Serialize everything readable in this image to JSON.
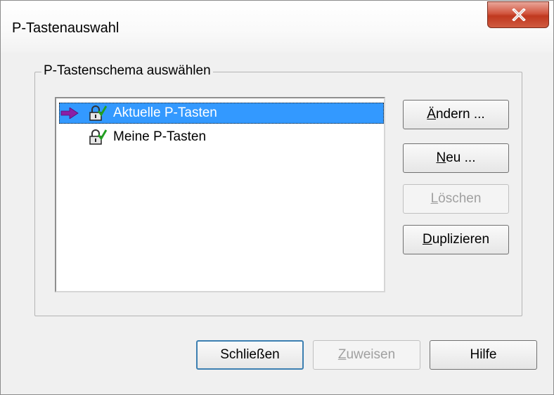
{
  "window": {
    "title": "P-Tastenauswahl"
  },
  "group": {
    "label": "P-Tastenschema auswählen"
  },
  "list": {
    "items": [
      {
        "label": "Aktuelle P-Tasten",
        "selected": true,
        "current": true
      },
      {
        "label": "Meine P-Tasten",
        "selected": false,
        "current": false
      }
    ]
  },
  "side_buttons": {
    "aendern": {
      "mnemonic": "Ä",
      "rest": "ndern ..."
    },
    "neu": {
      "mnemonic": "N",
      "rest": "eu ..."
    },
    "loeschen": {
      "mnemonic": "L",
      "rest": "öschen"
    },
    "duplizieren": {
      "mnemonic": "D",
      "rest": "uplizieren"
    }
  },
  "bottom_buttons": {
    "schliessen": "Schließen",
    "zuweisen": {
      "mnemonic": "Z",
      "rest": "uweisen"
    },
    "hilfe": "Hilfe"
  },
  "colors": {
    "selection": "#3399ff",
    "arrow": "#8b1fa6",
    "close_button": "#c0381f"
  },
  "icons": {
    "current_marker": "arrow-right-icon",
    "scheme": "lock-check-icon",
    "close": "close-icon"
  }
}
